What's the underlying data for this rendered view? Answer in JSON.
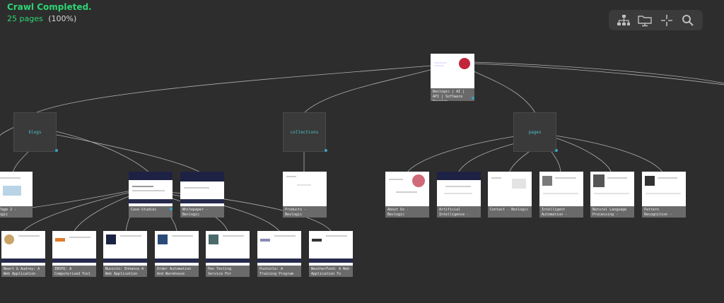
{
  "status": {
    "title": "Crawl Completed.",
    "pages": "25 pages",
    "percent": "(100%)"
  },
  "toolbar": {
    "icons": [
      "sitemap-icon",
      "folder-monitor-icon",
      "collapse-icon",
      "search-icon"
    ]
  },
  "root": {
    "label": "Beslogic | AI | API | Software Develop..."
  },
  "folders": [
    {
      "id": "blogs",
      "label": "blogs"
    },
    {
      "id": "collections",
      "label": "collections"
    },
    {
      "id": "pages",
      "label": "pages"
    }
  ],
  "cards": [
    {
      "id": "page2",
      "label": "... Page 2 - ...logic"
    },
    {
      "id": "case",
      "label": "Case-Studies"
    },
    {
      "id": "white",
      "label": "Whitepaper - Beslogic"
    },
    {
      "id": "products",
      "label": "Products - Beslogic"
    },
    {
      "id": "about",
      "label": "About Us - Beslogic"
    },
    {
      "id": "ai",
      "label": "Artificial Intelligence - Bes..."
    },
    {
      "id": "contact",
      "label": "Contact - Beslogic"
    },
    {
      "id": "intell",
      "label": "Intelligent Automation - Beslo..."
    },
    {
      "id": "nlp",
      "label": "Natural Language Processing - Beslo..."
    },
    {
      "id": "pattern",
      "label": "Pattern Recognition - Beslogic"
    },
    {
      "id": "c1",
      "label": "Beart & Audrey: A Web Application For..."
    },
    {
      "id": "c2",
      "label": "INSPQ: A Computerized Tool ..."
    },
    {
      "id": "c3",
      "label": "Nuvisto: Enhance A Web Application Fo..."
    },
    {
      "id": "c4",
      "label": "Order Automation And Warehouse Cont..."
    },
    {
      "id": "c5",
      "label": "Pen Testing Service For Tracking And A..."
    },
    {
      "id": "c6",
      "label": "Pushinle: A Training Program F..."
    },
    {
      "id": "c7",
      "label": "WeatherFund: A Web Application To Man..."
    }
  ]
}
